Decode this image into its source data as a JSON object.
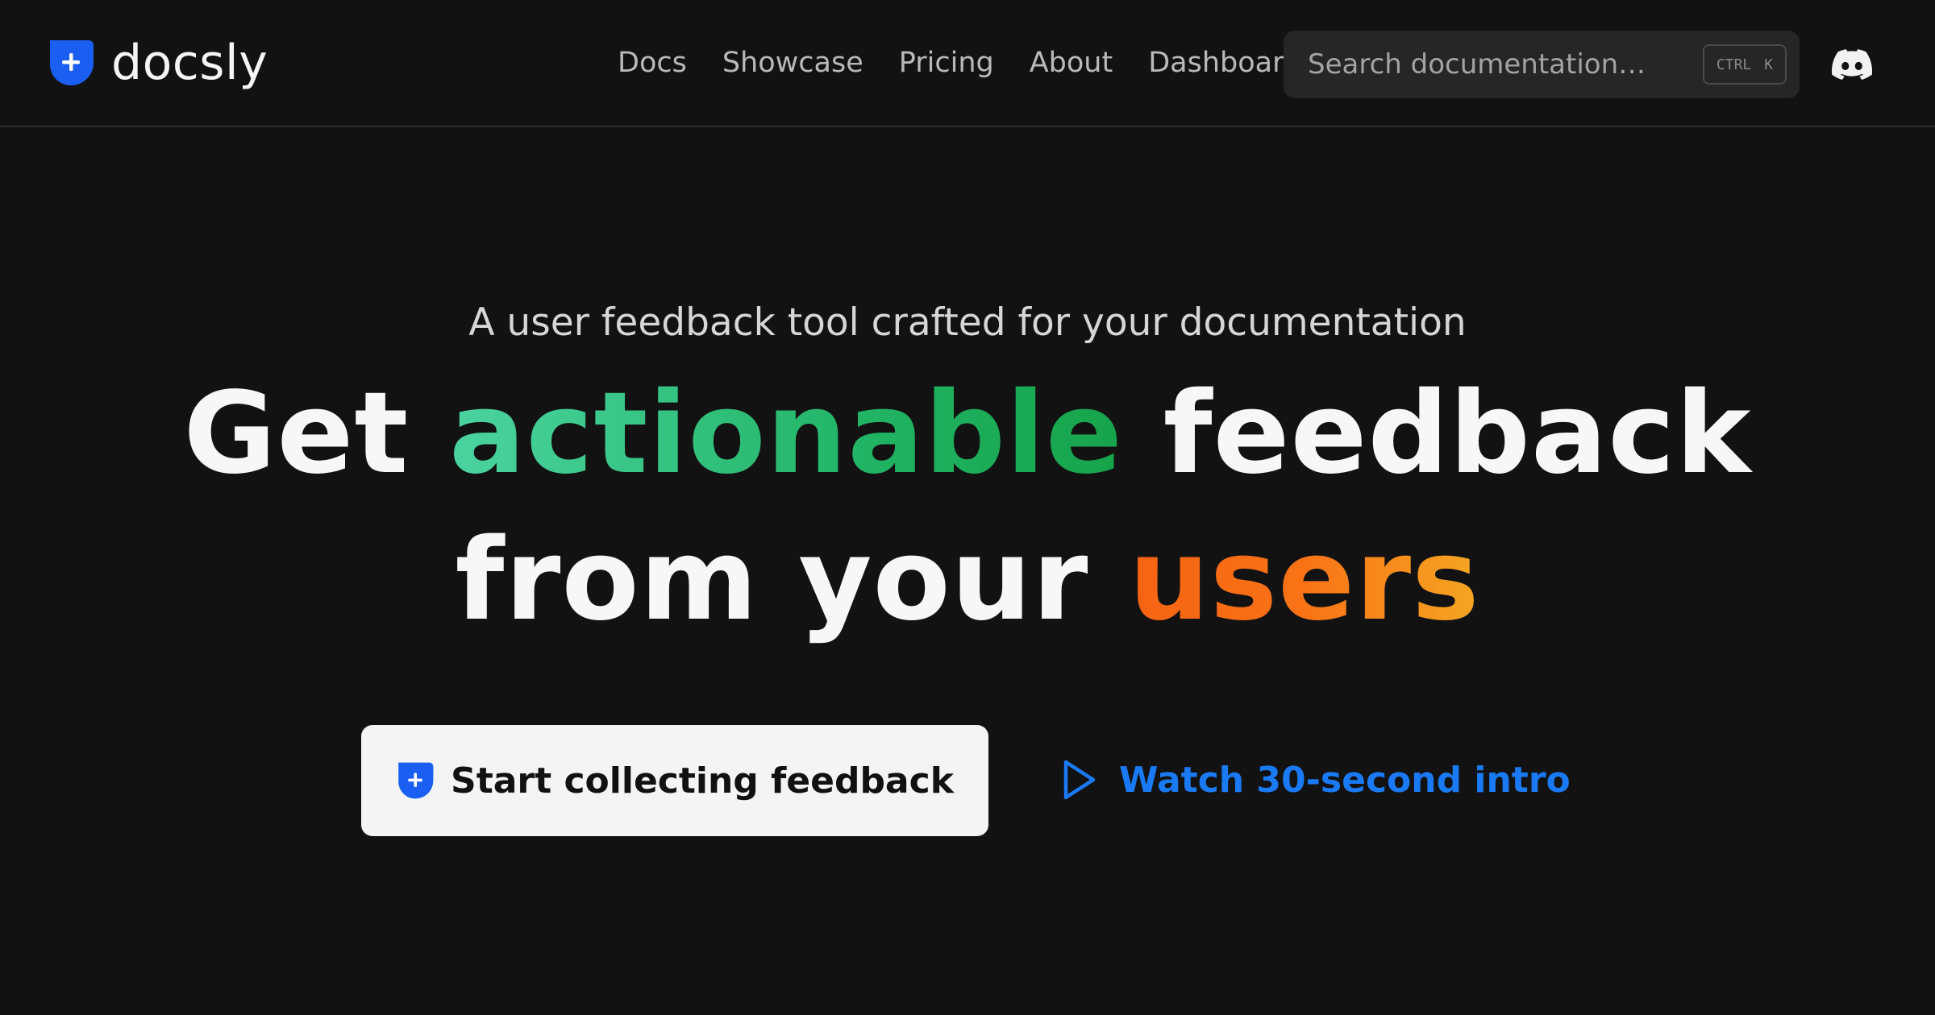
{
  "brand": {
    "name": "docsly",
    "accent_color": "#1a5ff2",
    "logo_icon": "shield-plus-icon"
  },
  "nav": {
    "items": [
      {
        "label": "Docs"
      },
      {
        "label": "Showcase"
      },
      {
        "label": "Pricing"
      },
      {
        "label": "About"
      },
      {
        "label": "Dashboard"
      }
    ]
  },
  "search": {
    "placeholder": "Search documentation…",
    "shortcut_modifier": "CTRL",
    "shortcut_key": "K",
    "icon": "keyboard-shortcut"
  },
  "social": {
    "icon": "discord-icon"
  },
  "hero": {
    "tagline": "A user feedback tool crafted for your documentation",
    "headline": {
      "line1_prefix": "Get ",
      "line1_highlight": "actionable",
      "line1_suffix": " feedback",
      "line2_prefix": "from your ",
      "line2_highlight": "users"
    },
    "colors": {
      "green_highlight": "#22b566",
      "orange_highlight": "#f97316",
      "link_blue": "#1a7af5"
    }
  },
  "actions": {
    "primary_label": "Start collecting feedback",
    "primary_icon": "shield-plus-icon",
    "secondary_label": "Watch 30-second intro",
    "secondary_icon": "play-icon"
  }
}
